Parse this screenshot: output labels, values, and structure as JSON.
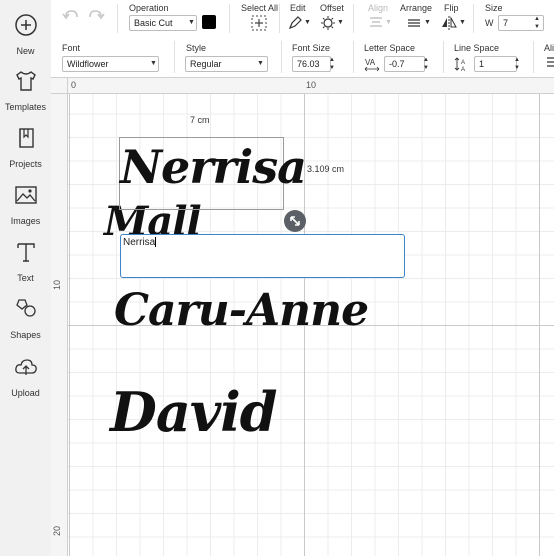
{
  "sidebar": {
    "items": [
      {
        "label": "New",
        "icon": "plus-circle-icon"
      },
      {
        "label": "Templates",
        "icon": "tshirt-icon"
      },
      {
        "label": "Projects",
        "icon": "book-icon"
      },
      {
        "label": "Images",
        "icon": "image-icon"
      },
      {
        "label": "Text",
        "icon": "text-icon"
      },
      {
        "label": "Shapes",
        "icon": "shapes-icon"
      },
      {
        "label": "Upload",
        "icon": "cloud-upload-icon"
      }
    ]
  },
  "toolbar": {
    "operation_label": "Operation",
    "operation_value": "Basic Cut",
    "operation_color": "#000000",
    "select_all_label": "Select All",
    "edit_label": "Edit",
    "offset_label": "Offset",
    "align_label": "Align",
    "arrange_label": "Arrange",
    "flip_label": "Flip",
    "size_label": "Size",
    "size_w_label": "W",
    "size_w_value": "7"
  },
  "text_toolbar": {
    "font_label": "Font",
    "font_value": "Wildflower",
    "style_label": "Style",
    "style_value": "Regular",
    "font_size_label": "Font Size",
    "font_size_value": "76.03",
    "letter_space_label": "Letter Space",
    "letter_space_value": "-0.7",
    "line_space_label": "Line Space",
    "line_space_value": "1",
    "align_label": "Alic"
  },
  "ruler": {
    "top": [
      "0",
      "10"
    ],
    "left": [
      "10",
      "20"
    ]
  },
  "canvas": {
    "width_label": "7 cm",
    "height_label": "3.109 cm",
    "text_box_value": "Nerrisa",
    "lines": [
      "Nerrisa",
      "Mall",
      "Caru-Anne",
      "David"
    ]
  }
}
